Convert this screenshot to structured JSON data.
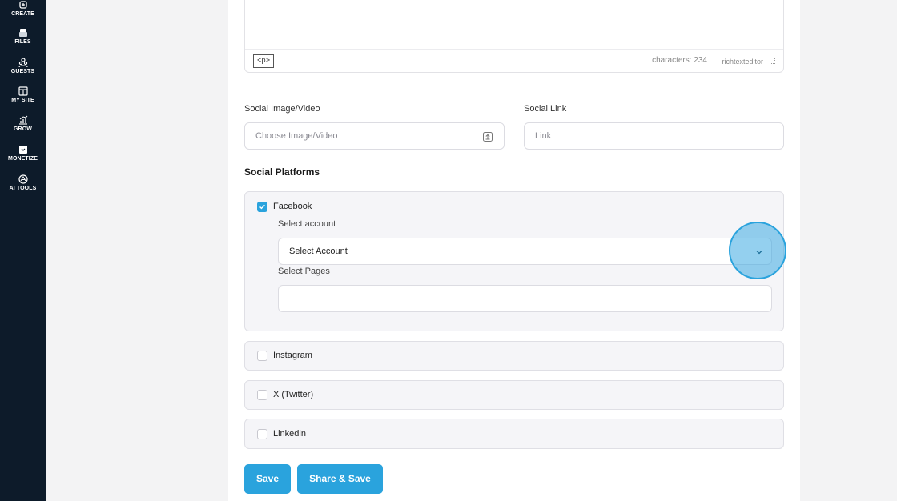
{
  "sidebar": {
    "items": [
      {
        "label": "CREATE",
        "icon": "create-icon"
      },
      {
        "label": "FILES",
        "icon": "files-icon"
      },
      {
        "label": "GUESTS",
        "icon": "guests-icon"
      },
      {
        "label": "MY SITE",
        "icon": "my-site-icon"
      },
      {
        "label": "GROW",
        "icon": "grow-icon"
      },
      {
        "label": "MONETIZE",
        "icon": "monetize-icon"
      },
      {
        "label": "AI TOOLS",
        "icon": "ai-tools-icon"
      }
    ]
  },
  "editor": {
    "tag": "<p>",
    "characters": "characters: 234",
    "brand": "richtexteditor"
  },
  "social_media": {
    "label": "Social Image/Video",
    "placeholder": "Choose Image/Video"
  },
  "social_link": {
    "label": "Social Link",
    "placeholder": "Link"
  },
  "platforms": {
    "title": "Social Platforms",
    "facebook": {
      "label": "Facebook",
      "checked": true,
      "account_label": "Select account",
      "account_value": "Select Account",
      "pages_label": "Select Pages"
    },
    "instagram": {
      "label": "Instagram",
      "checked": false
    },
    "twitter": {
      "label": "X (Twitter)",
      "checked": false
    },
    "linkedin": {
      "label": "Linkedin",
      "checked": false
    }
  },
  "actions": {
    "save": "Save",
    "share_save": "Share & Save"
  },
  "colors": {
    "sidebar_bg": "#0d1b2a",
    "accent": "#2aa3dd"
  }
}
